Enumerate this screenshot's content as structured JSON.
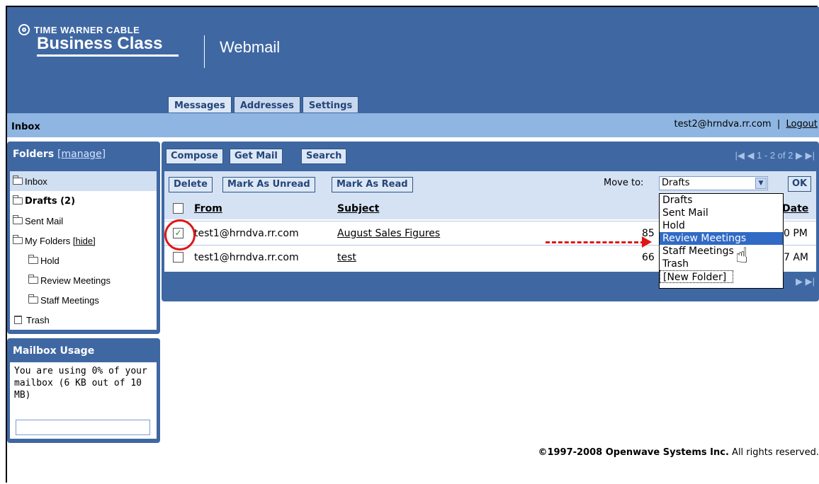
{
  "brand": {
    "line1": "TIME WARNER CABLE",
    "line2": "Business Class",
    "product": "Webmail"
  },
  "tabs": [
    {
      "label": "Messages"
    },
    {
      "label": "Addresses"
    },
    {
      "label": "Settings"
    }
  ],
  "inbox_bar": {
    "title": "Inbox",
    "account": "test2@hrndva.rr.com",
    "sep": "|",
    "logout": "Logout"
  },
  "folders": {
    "title": "Folders",
    "manage": "[manage]",
    "items": [
      {
        "label": "Inbox"
      },
      {
        "label": "Drafts (2)"
      },
      {
        "label": "Sent Mail"
      },
      {
        "label": "My Folders",
        "extra": "[hide]"
      },
      {
        "label": "Hold"
      },
      {
        "label": "Review Meetings"
      },
      {
        "label": "Staff Meetings"
      },
      {
        "label": "Trash"
      }
    ]
  },
  "usage": {
    "title": "Mailbox Usage",
    "text": "You are using 0% of your mailbox (6 KB out of 10 MB)",
    "percent": 0
  },
  "toolbar": {
    "compose": "Compose",
    "get_mail": "Get Mail",
    "search": "Search",
    "pager": "1 - 2 of 2"
  },
  "actions": {
    "delete": "Delete",
    "mark_unread": "Mark As Unread",
    "mark_read": "Mark As Read",
    "move_to": "Move to:",
    "selected": "Drafts",
    "ok": "OK"
  },
  "columns": {
    "from": "From",
    "subject": "Subject",
    "date": "Date"
  },
  "messages": [
    {
      "checked": true,
      "from": "test1@hrndva.rr.com",
      "subject": "August Sales Figures",
      "size": "85",
      "date": "0 PM"
    },
    {
      "checked": false,
      "from": "test1@hrndva.rr.com",
      "subject": "test",
      "size": "66",
      "date": "7 AM"
    }
  ],
  "dropdown": [
    "Drafts",
    "Sent Mail",
    "Hold",
    "Review Meetings",
    "Staff Meetings",
    "Trash",
    "[New Folder]"
  ],
  "footer": {
    "company": "©1997-2008 Openwave Systems Inc.",
    "rights": "All rights reserved."
  }
}
